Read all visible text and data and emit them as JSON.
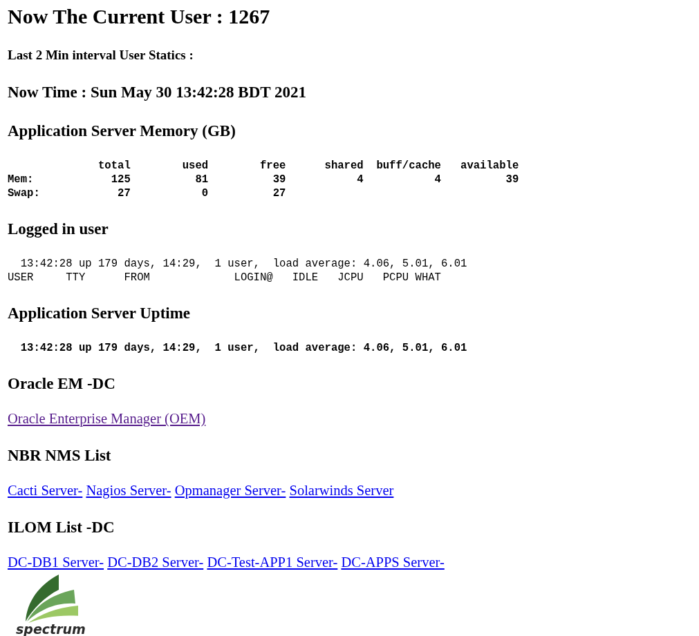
{
  "title": "Now The Current User : 1267",
  "interval_label": "Last 2 Min interval User Statics :",
  "now_time": "Now Time : Sun May 30 13:42:28 BDT 2021",
  "sections": [
    {
      "kind": "pre",
      "heading": "Application Server Memory (GB)",
      "bold": true,
      "lines": [
        "              total        used        free      shared  buff/cache   available",
        "Mem:            125          81          39           4           4          39",
        "Swap:            27           0          27"
      ]
    },
    {
      "kind": "pre",
      "heading": "Logged in user",
      "bold": false,
      "lines": [
        "  13:42:28 up 179 days, 14:29,  1 user,  load average: 4.06, 5.01, 6.01",
        "USER     TTY      FROM             LOGIN@   IDLE   JCPU   PCPU WHAT"
      ]
    },
    {
      "kind": "pre",
      "heading": "Application Server Uptime",
      "bold": true,
      "lines": [
        "  13:42:28 up 179 days, 14:29,  1 user,  load average: 4.06, 5.01, 6.01"
      ]
    },
    {
      "kind": "links",
      "heading": "Oracle EM -DC",
      "links": [
        {
          "label": "Oracle Enterprise Manager (OEM)",
          "visited": true
        }
      ]
    },
    {
      "kind": "links",
      "heading": "NBR NMS List",
      "links": [
        {
          "label": "Cacti Server-",
          "visited": false
        },
        {
          "label": "Nagios Server-",
          "visited": false
        },
        {
          "label": "Opmanager Server-",
          "visited": false
        },
        {
          "label": "Solarwinds Server",
          "visited": false
        }
      ]
    },
    {
      "kind": "links",
      "heading": "ILOM List -DC",
      "links": [
        {
          "label": "DC-DB1 Server-",
          "visited": false
        },
        {
          "label": "DC-DB2 Server-",
          "visited": false
        },
        {
          "label": "DC-Test-APP1 Server-",
          "visited": false
        },
        {
          "label": "DC-APPS Server-",
          "visited": false
        }
      ]
    }
  ],
  "logo": {
    "text": "spectrum"
  }
}
